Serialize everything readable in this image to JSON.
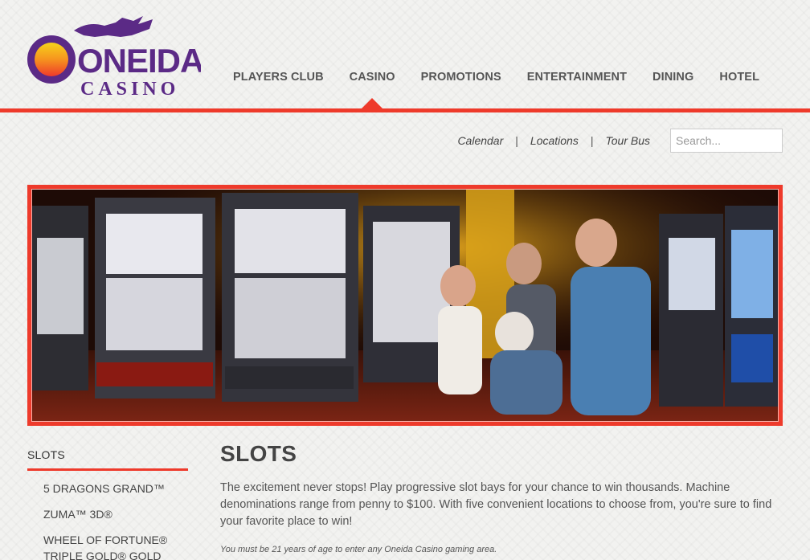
{
  "brand": {
    "name_top": "ONEIDA",
    "name_bottom": "CASINO",
    "accent": "#ee3a2b",
    "purple": "#5b2a86"
  },
  "nav": {
    "items": [
      {
        "label": "PLAYERS CLUB"
      },
      {
        "label": "CASINO",
        "active": true
      },
      {
        "label": "PROMOTIONS"
      },
      {
        "label": "ENTERTAINMENT"
      },
      {
        "label": "DINING"
      },
      {
        "label": "HOTEL"
      }
    ]
  },
  "utility": {
    "links": [
      "Calendar",
      "Locations",
      "Tour Bus"
    ],
    "separator": "|",
    "search_placeholder": "Search..."
  },
  "sidebar": {
    "title": "SLOTS",
    "items": [
      "5 DRAGONS GRAND™",
      "ZUMA™ 3D®",
      "WHEEL OF FORTUNE® TRIPLE GOLD® GOLD"
    ]
  },
  "main": {
    "title": "SLOTS",
    "intro": "The excitement never stops! Play progressive slot bays for your chance to win thousands. Machine denominations range from penny to $100. With five convenient locations to choose from, you're sure to find your favorite place to win!",
    "disclaimer": "You must be 21 years of age to enter any Oneida Casino gaming area."
  }
}
